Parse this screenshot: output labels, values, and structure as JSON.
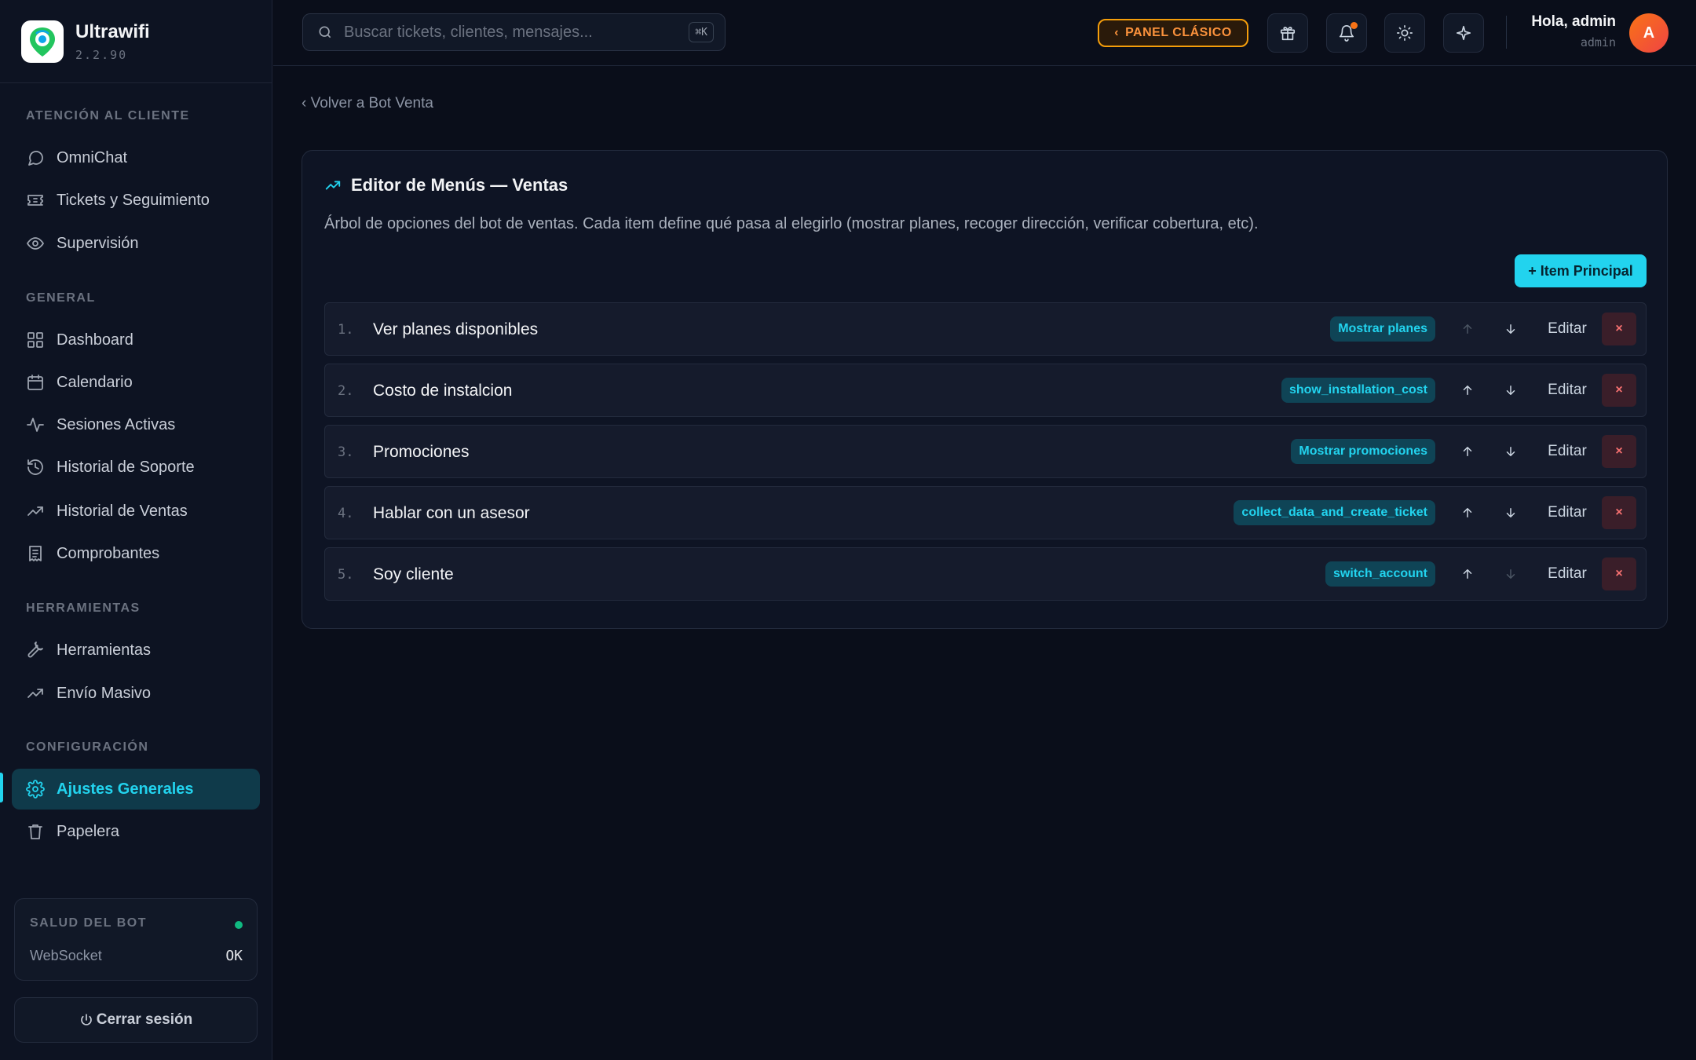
{
  "brand": {
    "name": "Ultrawifi",
    "version": "2.2.90"
  },
  "sidebar": {
    "sections": [
      {
        "title": "ATENCIÓN AL CLIENTE"
      },
      {
        "title": "GENERAL"
      },
      {
        "title": "HERRAMIENTAS"
      },
      {
        "title": "CONFIGURACIÓN"
      }
    ],
    "items": [
      {
        "label": "OmniChat",
        "icon": "chat-icon"
      },
      {
        "label": "Tickets y Seguimiento",
        "icon": "ticket-icon"
      },
      {
        "label": "Supervisión",
        "icon": "eye-icon"
      },
      {
        "label": "Dashboard",
        "icon": "grid-icon"
      },
      {
        "label": "Calendario",
        "icon": "calendar-icon"
      },
      {
        "label": "Sesiones Activas",
        "icon": "activity-icon"
      },
      {
        "label": "Historial de Soporte",
        "icon": "history-icon"
      },
      {
        "label": "Historial de Ventas",
        "icon": "trending-up-icon"
      },
      {
        "label": "Comprobantes",
        "icon": "receipt-icon"
      },
      {
        "label": "Herramientas",
        "icon": "wrench-icon"
      },
      {
        "label": "Envío Masivo",
        "icon": "trending-up-icon"
      },
      {
        "label": "Ajustes Generales",
        "icon": "gear-icon",
        "active": true
      },
      {
        "label": "Papelera",
        "icon": "trash-icon"
      }
    ],
    "health": {
      "title": "SALUD DEL BOT",
      "label": "WebSocket",
      "value": "OK",
      "status_color": "#10b981"
    },
    "logout_label": "Cerrar sesión"
  },
  "topbar": {
    "search_placeholder": "Buscar tickets, clientes, mensajes...",
    "search_shortcut": "⌘K",
    "classic_panel_label": "PANEL CLÁSICO",
    "user_greeting": "Hola, admin",
    "user_role": "admin",
    "avatar_initial": "A"
  },
  "main": {
    "back_link": "‹ Volver a Bot Venta",
    "card": {
      "title": "Editor de Menús — Ventas",
      "description": "Árbol de opciones del bot de ventas. Cada item define qué pasa al elegirlo (mostrar planes, recoger dirección, verificar cobertura, etc).",
      "add_button": "+ Item Principal",
      "edit_label": "Editar",
      "delete_label": "×",
      "items": [
        {
          "num": "1.",
          "label": "Ver planes disponibles",
          "action": "Mostrar planes"
        },
        {
          "num": "2.",
          "label": "Costo de instalcion",
          "action": "show_installation_cost"
        },
        {
          "num": "3.",
          "label": "Promociones",
          "action": "Mostrar promociones"
        },
        {
          "num": "4.",
          "label": "Hablar con un asesor",
          "action": "collect_data_and_create_ticket"
        },
        {
          "num": "5.",
          "label": "Soy cliente",
          "action": "switch_account"
        }
      ]
    }
  },
  "colors": {
    "accent": "#22d3ee",
    "warning": "#f59e0b",
    "danger": "#f87171",
    "background": "#0a0e1a"
  }
}
